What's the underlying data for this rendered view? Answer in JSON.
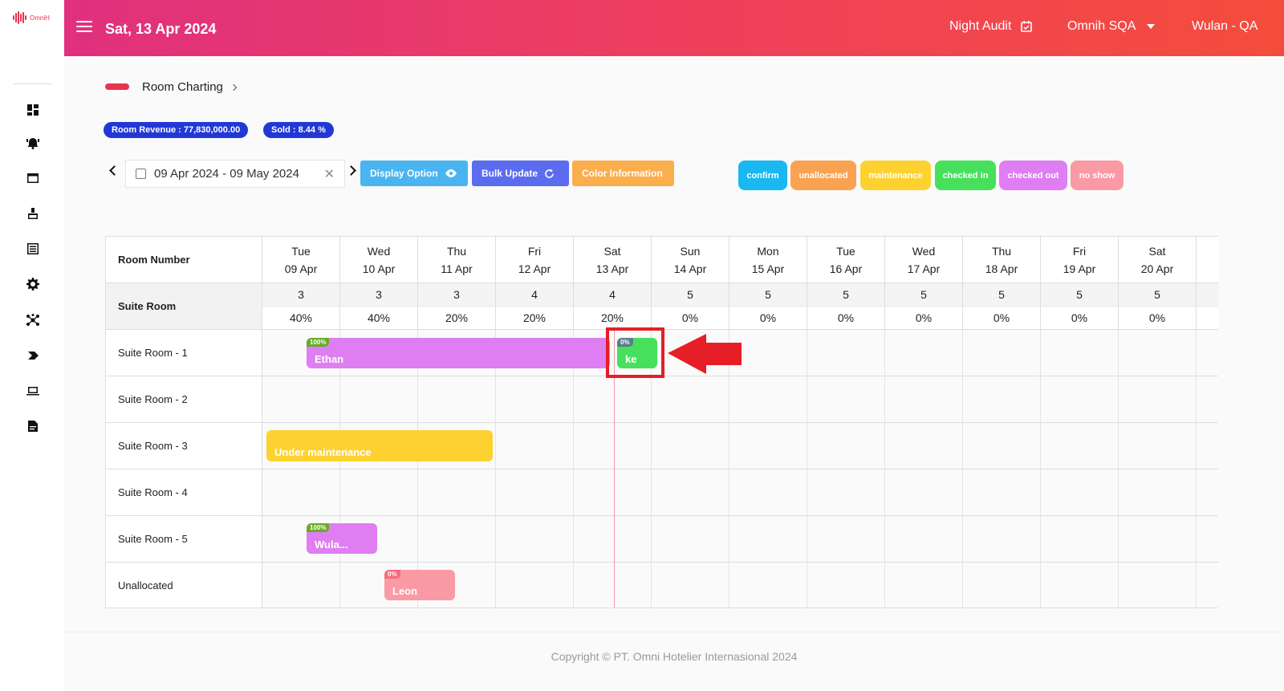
{
  "sidebar": {
    "logo_text": "OmniH",
    "icons": [
      "dashboard-icon",
      "alarm-icon",
      "folder-icon",
      "cleaning-icon",
      "list-icon",
      "gear-icon",
      "network-icon",
      "label-icon",
      "laptop-icon",
      "report-icon"
    ]
  },
  "header": {
    "date": "Sat, 13 Apr 2024",
    "night_audit": "Night Audit",
    "property": "Omnih SQA",
    "user": "Wulan - QA"
  },
  "breadcrumb": {
    "label": "Room Charting"
  },
  "badges": {
    "revenue": "Room Revenue : 77,830,000.00",
    "sold": "Sold : 8.44 %"
  },
  "date_range": "09 Apr 2024 - 09 May 2024",
  "buttons": {
    "display_option": "Display Option",
    "bulk_update": "Bulk Update",
    "color_info": "Color Information"
  },
  "legend": [
    {
      "label": "confirm",
      "color": "#1ab8f0"
    },
    {
      "label": "unallocated",
      "color": "#f9a352"
    },
    {
      "label": "maintenance",
      "color": "#fdd230"
    },
    {
      "label": "checked in",
      "color": "#47e05c"
    },
    {
      "label": "checked out",
      "color": "#de7ef2"
    },
    {
      "label": "no show",
      "color": "#f99aa4"
    }
  ],
  "grid": {
    "corner_label": "Room Number",
    "days": [
      {
        "dow": "Tue",
        "date": "09 Apr",
        "avail": "3",
        "occ": "40%"
      },
      {
        "dow": "Wed",
        "date": "10 Apr",
        "avail": "3",
        "occ": "40%"
      },
      {
        "dow": "Thu",
        "date": "11 Apr",
        "avail": "3",
        "occ": "20%"
      },
      {
        "dow": "Fri",
        "date": "12 Apr",
        "avail": "4",
        "occ": "20%"
      },
      {
        "dow": "Sat",
        "date": "13 Apr",
        "avail": "4",
        "occ": "20%"
      },
      {
        "dow": "Sun",
        "date": "14 Apr",
        "avail": "5",
        "occ": "0%"
      },
      {
        "dow": "Mon",
        "date": "15 Apr",
        "avail": "5",
        "occ": "0%"
      },
      {
        "dow": "Tue",
        "date": "16 Apr",
        "avail": "5",
        "occ": "0%"
      },
      {
        "dow": "Wed",
        "date": "17 Apr",
        "avail": "5",
        "occ": "0%"
      },
      {
        "dow": "Thu",
        "date": "18 Apr",
        "avail": "5",
        "occ": "0%"
      },
      {
        "dow": "Fri",
        "date": "19 Apr",
        "avail": "5",
        "occ": "0%"
      },
      {
        "dow": "Sat",
        "date": "20 Apr",
        "avail": "5",
        "occ": "0%"
      }
    ],
    "room_type": "Suite Room",
    "rooms": [
      "Suite Room - 1",
      "Suite Room - 2",
      "Suite Room - 3",
      "Suite Room - 4",
      "Suite Room - 5",
      "Unallocated"
    ]
  },
  "reservations": [
    {
      "name": "Ethan",
      "pct": "100%",
      "color": "#de7ef2",
      "pct_color": "#6aaa2a"
    },
    {
      "name": "ke",
      "pct": "0%",
      "color": "#47e05c",
      "pct_color": "#5b7d8e"
    },
    {
      "name": "Under maintenance",
      "pct": "",
      "color": "#fdd230",
      "pct_color": ""
    },
    {
      "name": "Wula...",
      "pct": "100%",
      "color": "#de7ef2",
      "pct_color": "#6aaa2a"
    },
    {
      "name": "Leon",
      "pct": "0%",
      "color": "#f99aa4",
      "pct_color": "#f56b7b"
    }
  ],
  "footer": "Copyright © PT. Omni Hotelier Internasional 2024"
}
